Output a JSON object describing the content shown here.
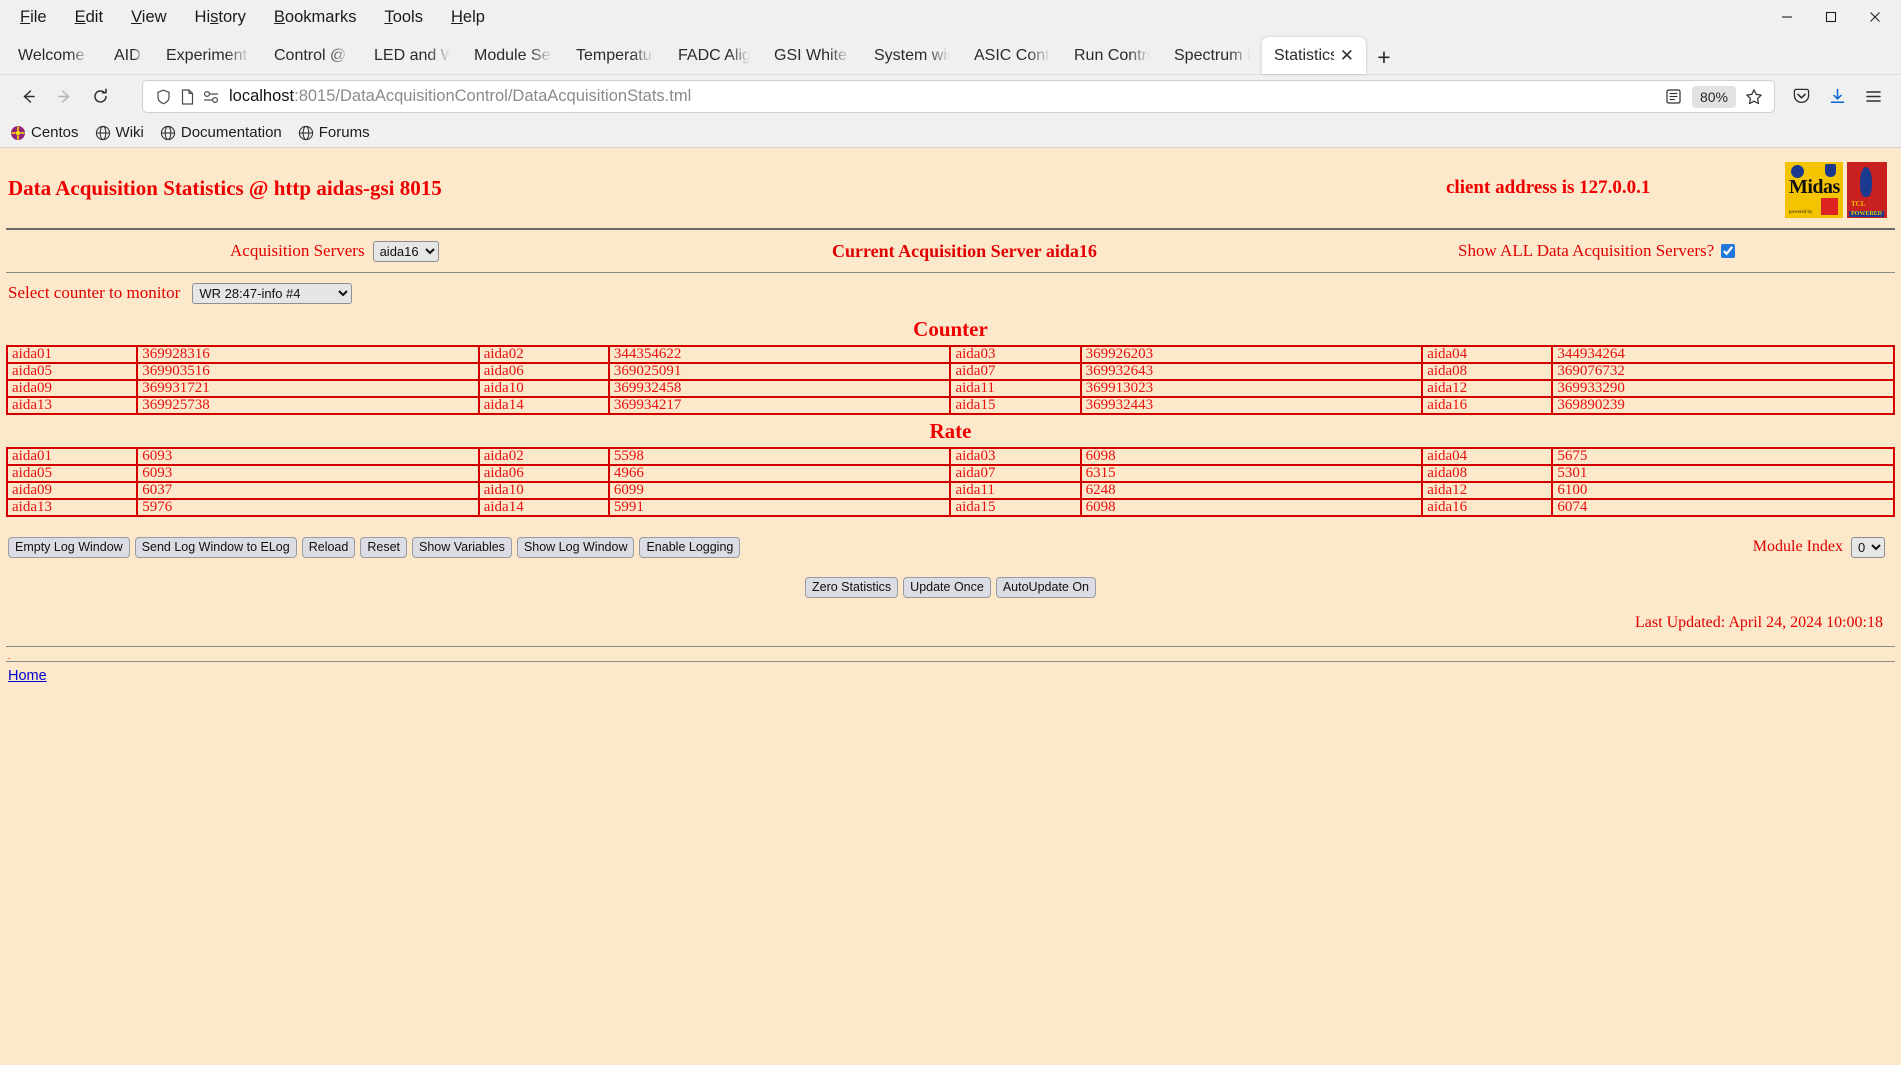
{
  "browser": {
    "menu": [
      "File",
      "Edit",
      "View",
      "History",
      "Bookmarks",
      "Tools",
      "Help"
    ],
    "window_controls": {
      "minimize": "—",
      "maximize": "▢",
      "close": "✕"
    },
    "tabs": [
      {
        "label": "Welcome to Cent",
        "active": false
      },
      {
        "label": "AIDA",
        "active": false
      },
      {
        "label": "Experiment Contr",
        "active": false
      },
      {
        "label": "Control @ aidas-",
        "active": false
      },
      {
        "label": "LED and Wavefor",
        "active": false
      },
      {
        "label": "Module Settings ",
        "active": false
      },
      {
        "label": "Temperature and",
        "active": false
      },
      {
        "label": "FADC Align & Co",
        "active": false
      },
      {
        "label": "GSI White Rabbit",
        "active": false
      },
      {
        "label": "System wide Che",
        "active": false
      },
      {
        "label": "ASIC Control @ a",
        "active": false
      },
      {
        "label": "Run Control @ ai",
        "active": false
      },
      {
        "label": "Spectrum Browse",
        "active": false
      },
      {
        "label": "Statistics @ aid",
        "active": true
      }
    ],
    "new_tab_label": "+",
    "nav": {
      "back": "←",
      "forward": "→",
      "reload": "⟳",
      "url_host": "localhost",
      "url_rest": ":8015/DataAcquisitionControl/DataAcquisitionStats.tml",
      "zoom_level": "80%",
      "reader_icon": "reader-view-icon",
      "bookmark_icon": "star-icon",
      "pocket_icon": "pocket-icon",
      "downloads_icon": "download-icon",
      "menu_icon": "hamburger-menu-icon"
    },
    "bookmarks": [
      "Centos",
      "Wiki",
      "Documentation",
      "Forums"
    ]
  },
  "page": {
    "title": "Data Acquisition Statistics @ http aidas-gsi 8015",
    "client_address": "client address is 127.0.0.1",
    "acquisition_servers_label": "Acquisition Servers",
    "acquisition_servers_value": "aida16",
    "acquisition_servers_options": [
      "aida16"
    ],
    "current_server": "Current Acquisition Server aida16",
    "show_all_label": "Show ALL Data Acquisition Servers?",
    "show_all_checked": true,
    "select_counter_label": "Select counter to monitor",
    "select_counter_value": "WR 28:47-info #4",
    "select_counter_options": [
      "WR 28:47-info #4"
    ],
    "counter_title": "Counter",
    "rate_title": "Rate",
    "counter_rows": [
      [
        [
          "aida01",
          "369928316"
        ],
        [
          "aida02",
          "344354622"
        ],
        [
          "aida03",
          "369926203"
        ],
        [
          "aida04",
          "344934264"
        ]
      ],
      [
        [
          "aida05",
          "369903516"
        ],
        [
          "aida06",
          "369025091"
        ],
        [
          "aida07",
          "369932643"
        ],
        [
          "aida08",
          "369076732"
        ]
      ],
      [
        [
          "aida09",
          "369931721"
        ],
        [
          "aida10",
          "369932458"
        ],
        [
          "aida11",
          "369913023"
        ],
        [
          "aida12",
          "369933290"
        ]
      ],
      [
        [
          "aida13",
          "369925738"
        ],
        [
          "aida14",
          "369934217"
        ],
        [
          "aida15",
          "369932443"
        ],
        [
          "aida16",
          "369890239"
        ]
      ]
    ],
    "rate_rows": [
      [
        [
          "aida01",
          "6093"
        ],
        [
          "aida02",
          "5598"
        ],
        [
          "aida03",
          "6098"
        ],
        [
          "aida04",
          "5675"
        ]
      ],
      [
        [
          "aida05",
          "6093"
        ],
        [
          "aida06",
          "4966"
        ],
        [
          "aida07",
          "6315"
        ],
        [
          "aida08",
          "5301"
        ]
      ],
      [
        [
          "aida09",
          "6037"
        ],
        [
          "aida10",
          "6099"
        ],
        [
          "aida11",
          "6248"
        ],
        [
          "aida12",
          "6100"
        ]
      ],
      [
        [
          "aida13",
          "5976"
        ],
        [
          "aida14",
          "5991"
        ],
        [
          "aida15",
          "6098"
        ],
        [
          "aida16",
          "6074"
        ]
      ]
    ],
    "log_buttons": [
      "Empty Log Window",
      "Send Log Window to ELog",
      "Reload",
      "Reset",
      "Show Variables",
      "Show Log Window",
      "Enable Logging"
    ],
    "module_index_label": "Module Index",
    "module_index_value": "0",
    "module_index_options": [
      "0"
    ],
    "action_buttons": [
      "Zero Statistics",
      "Update Once",
      "AutoUpdate On"
    ],
    "last_updated": "Last Updated: April 24, 2024 10:00:18",
    "home_link": "Home",
    "dot": "."
  },
  "colors": {
    "page_bg": "#fce9cb",
    "text_red": "#ee0000",
    "table_border": "#d40000",
    "link_blue": "#0000cc"
  }
}
